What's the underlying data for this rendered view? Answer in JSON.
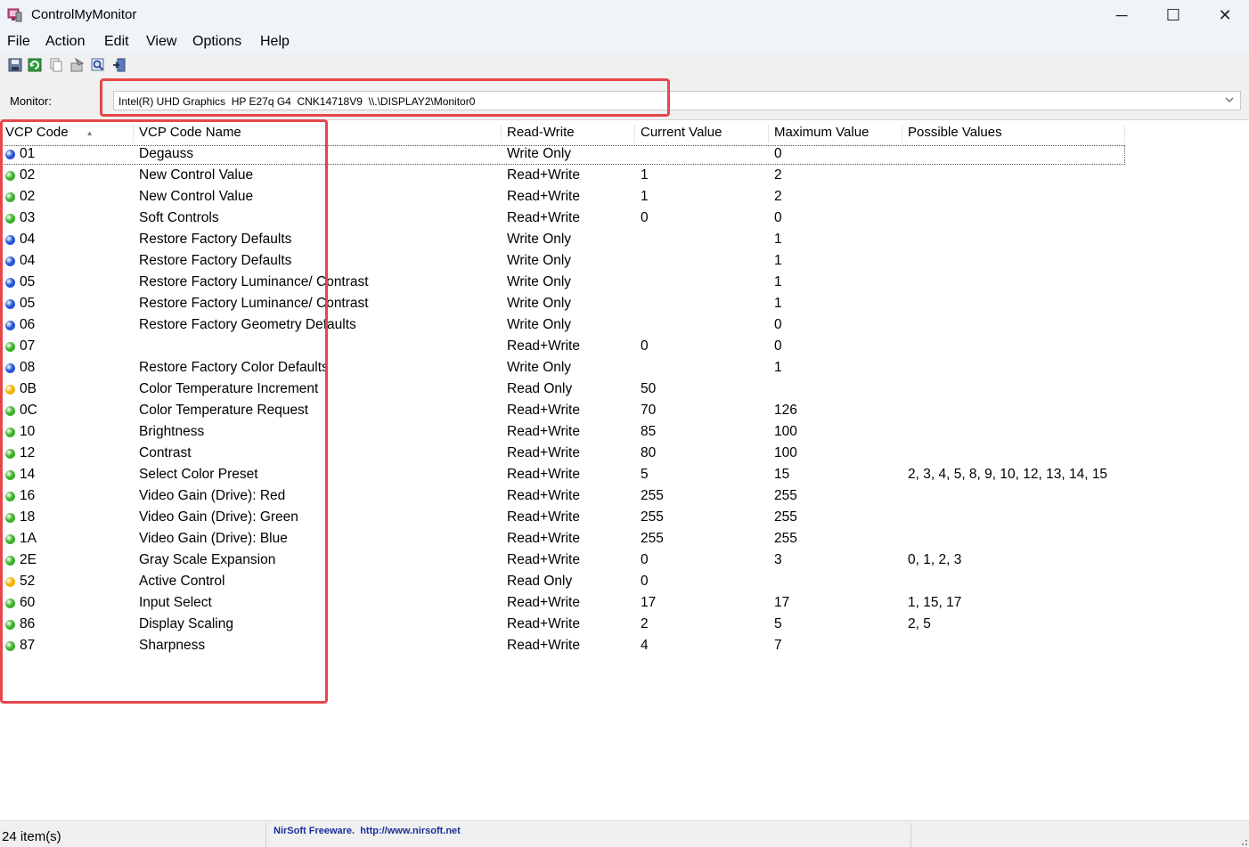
{
  "window": {
    "title": "ControlMyMonitor",
    "minimize_glyph": "─",
    "maximize_glyph": "☐",
    "close_glyph": "✕"
  },
  "menu": [
    "File",
    "Action",
    "Edit",
    "View",
    "Options",
    "Help"
  ],
  "toolbar": {
    "icons": [
      "save-icon",
      "refresh-icon",
      "copy-icon",
      "properties-icon",
      "find-icon",
      "exit-icon"
    ]
  },
  "monitor": {
    "label": "Monitor:",
    "selected": "Intel(R) UHD Graphics  HP E27q G4  CNK14718V9  \\\\.\\DISPLAY2\\Monitor0"
  },
  "columns": [
    "VCP Code",
    "VCP Code Name",
    "Read-Write",
    "Current Value",
    "Maximum Value",
    "Possible Values"
  ],
  "sort_indicator": "▲",
  "dot_colors": {
    "write_only": "#2555d6",
    "read_write": "#3bb12a",
    "read_only": "#f0b400"
  },
  "rows": [
    {
      "code": "01",
      "name": "Degauss",
      "rw": "Write Only",
      "current": "",
      "max": "0",
      "possible": "",
      "status": "write_only"
    },
    {
      "code": "02",
      "name": "New Control Value",
      "rw": "Read+Write",
      "current": "1",
      "max": "2",
      "possible": "",
      "status": "read_write"
    },
    {
      "code": "02",
      "name": "New Control Value",
      "rw": "Read+Write",
      "current": "1",
      "max": "2",
      "possible": "",
      "status": "read_write"
    },
    {
      "code": "03",
      "name": "Soft Controls",
      "rw": "Read+Write",
      "current": "0",
      "max": "0",
      "possible": "",
      "status": "read_write"
    },
    {
      "code": "04",
      "name": "Restore Factory Defaults",
      "rw": "Write Only",
      "current": "",
      "max": "1",
      "possible": "",
      "status": "write_only"
    },
    {
      "code": "04",
      "name": "Restore Factory Defaults",
      "rw": "Write Only",
      "current": "",
      "max": "1",
      "possible": "",
      "status": "write_only"
    },
    {
      "code": "05",
      "name": "Restore Factory Luminance/ Contrast",
      "rw": "Write Only",
      "current": "",
      "max": "1",
      "possible": "",
      "status": "write_only"
    },
    {
      "code": "05",
      "name": "Restore Factory Luminance/ Contrast",
      "rw": "Write Only",
      "current": "",
      "max": "1",
      "possible": "",
      "status": "write_only"
    },
    {
      "code": "06",
      "name": "Restore Factory Geometry Defaults",
      "rw": "Write Only",
      "current": "",
      "max": "0",
      "possible": "",
      "status": "write_only"
    },
    {
      "code": "07",
      "name": "",
      "rw": "Read+Write",
      "current": "0",
      "max": "0",
      "possible": "",
      "status": "read_write"
    },
    {
      "code": "08",
      "name": "Restore Factory Color Defaults",
      "rw": "Write Only",
      "current": "",
      "max": "1",
      "possible": "",
      "status": "write_only"
    },
    {
      "code": "0B",
      "name": "Color Temperature Increment",
      "rw": "Read Only",
      "current": "50",
      "max": "",
      "possible": "",
      "status": "read_only"
    },
    {
      "code": "0C",
      "name": "Color Temperature Request",
      "rw": "Read+Write",
      "current": "70",
      "max": "126",
      "possible": "",
      "status": "read_write"
    },
    {
      "code": "10",
      "name": "Brightness",
      "rw": "Read+Write",
      "current": "85",
      "max": "100",
      "possible": "",
      "status": "read_write"
    },
    {
      "code": "12",
      "name": "Contrast",
      "rw": "Read+Write",
      "current": "80",
      "max": "100",
      "possible": "",
      "status": "read_write"
    },
    {
      "code": "14",
      "name": "Select Color Preset",
      "rw": "Read+Write",
      "current": "5",
      "max": "15",
      "possible": "2, 3, 4, 5, 8, 9, 10, 12, 13, 14, 15",
      "status": "read_write"
    },
    {
      "code": "16",
      "name": "Video Gain (Drive): Red",
      "rw": "Read+Write",
      "current": "255",
      "max": "255",
      "possible": "",
      "status": "read_write"
    },
    {
      "code": "18",
      "name": "Video Gain (Drive): Green",
      "rw": "Read+Write",
      "current": "255",
      "max": "255",
      "possible": "",
      "status": "read_write"
    },
    {
      "code": "1A",
      "name": "Video Gain (Drive): Blue",
      "rw": "Read+Write",
      "current": "255",
      "max": "255",
      "possible": "",
      "status": "read_write"
    },
    {
      "code": "2E",
      "name": "Gray Scale Expansion",
      "rw": "Read+Write",
      "current": "0",
      "max": "3",
      "possible": "0, 1, 2, 3",
      "status": "read_write"
    },
    {
      "code": "52",
      "name": "Active Control",
      "rw": "Read Only",
      "current": "0",
      "max": "",
      "possible": "",
      "status": "read_only"
    },
    {
      "code": "60",
      "name": "Input Select",
      "rw": "Read+Write",
      "current": "17",
      "max": "17",
      "possible": "1, 15, 17",
      "status": "read_write"
    },
    {
      "code": "86",
      "name": "Display Scaling",
      "rw": "Read+Write",
      "current": "2",
      "max": "5",
      "possible": "2, 5",
      "status": "read_write"
    },
    {
      "code": "87",
      "name": "Sharpness",
      "rw": "Read+Write",
      "current": "4",
      "max": "7",
      "possible": "",
      "status": "read_write"
    }
  ],
  "status": {
    "count": "24 item(s)",
    "credit": "NirSoft Freeware.  http://www.nirsoft.net"
  },
  "annotation_color": "#e8464a"
}
